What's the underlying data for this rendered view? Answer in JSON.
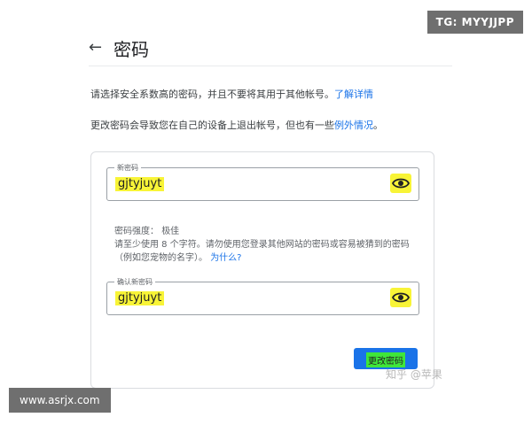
{
  "watermarks": {
    "top_right": "TG: MYYJJPP",
    "bottom_left": "www.asrjx.com",
    "zhihu": "知乎 @苹果"
  },
  "header": {
    "title": "密码"
  },
  "intro": {
    "line1_text": "请选择安全系数高的密码，并且不要将其用于其他帐号。",
    "line1_link": "了解详情",
    "line2_text": "更改密码会导致您在自己的设备上退出帐号，但也有一些",
    "line2_link": "例外情况",
    "line2_end": "。"
  },
  "form": {
    "new_password": {
      "label": "新密码",
      "value": "gjtyjuyt"
    },
    "strength_label": "密码强度：",
    "strength_value": "极佳",
    "hint_line1": "请至少使用 8 个字符。请勿使用您登录其他网站的密码或容易被猜到的密码",
    "hint_line2": "（例如您宠物的名字）。",
    "hint_link": "为什么?",
    "confirm_password": {
      "label": "确认新密码",
      "value": "gjtyjuyt"
    },
    "submit_label": "更改密码"
  },
  "colors": {
    "highlight": "#f8f437",
    "primary": "#1a73e8",
    "button_highlight": "#3fe63a"
  },
  "icons": {
    "back": "arrow-left-icon",
    "toggle_visibility": "eye-icon"
  }
}
